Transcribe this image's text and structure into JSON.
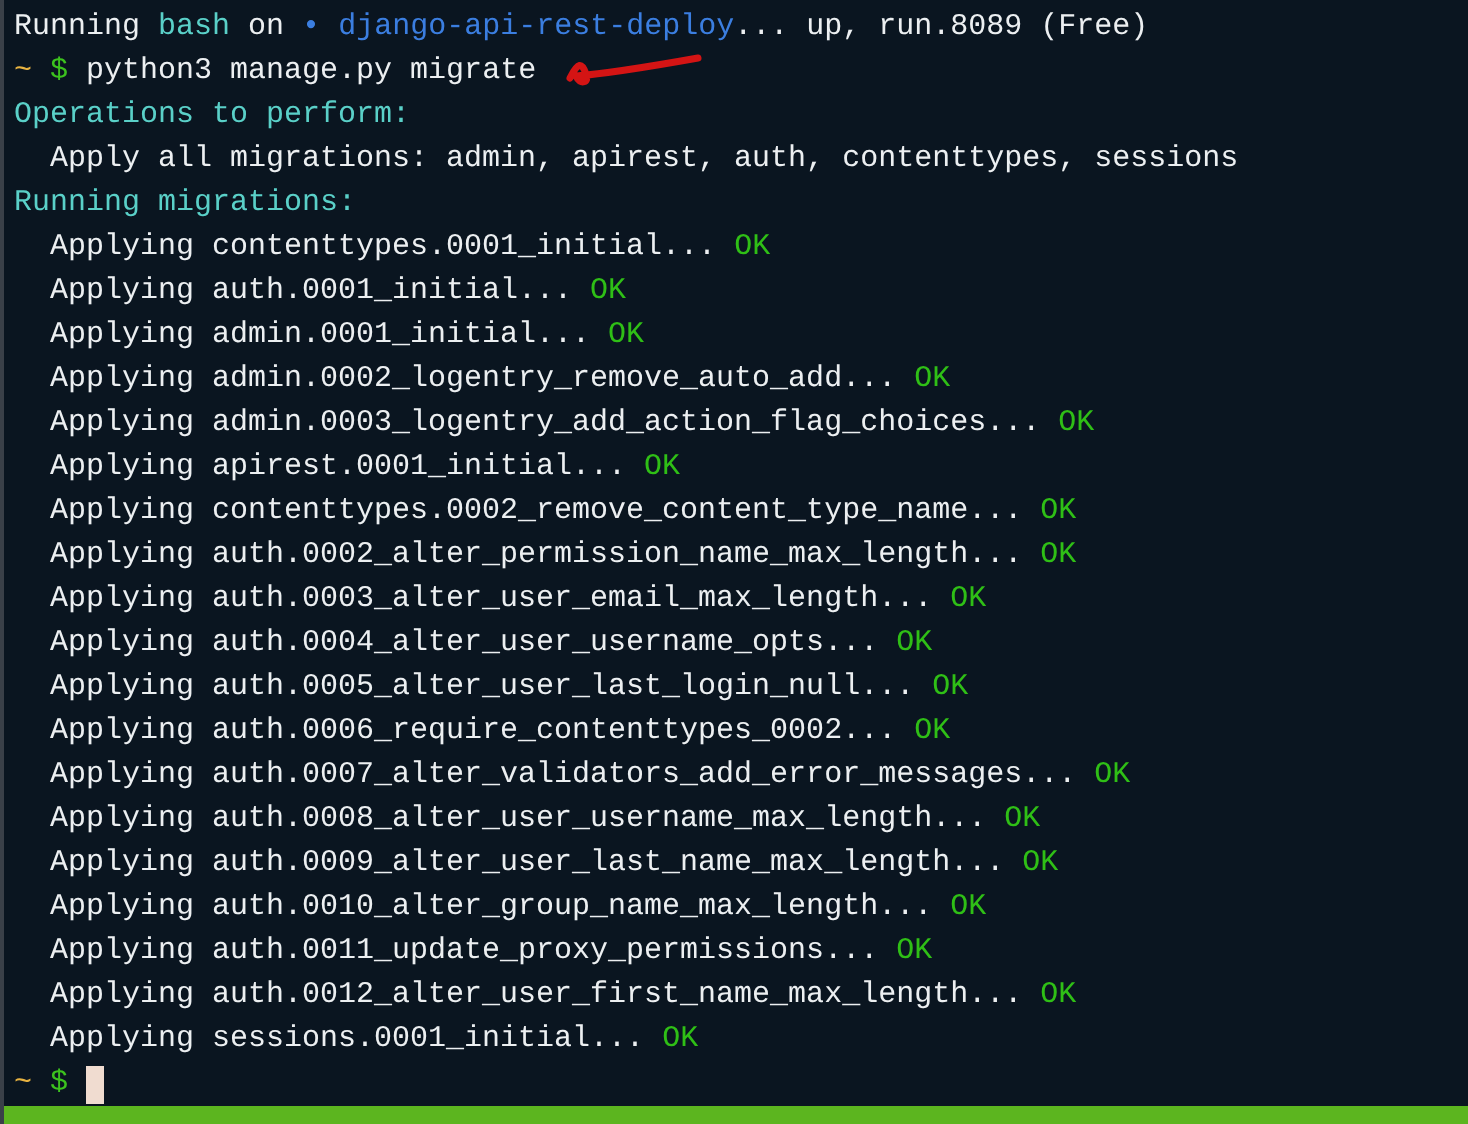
{
  "header": {
    "prefix": "Running",
    "shell": "bash",
    "on": "on",
    "bullet": "•",
    "project": "django-api-rest-deploy",
    "rest": "... up, run.8089 (Free)"
  },
  "prompt": {
    "dir": "~",
    "symbol": "$",
    "command": "python3 manage.py migrate"
  },
  "lines": [
    {
      "kind": "heading",
      "text": "Operations to perform:"
    },
    {
      "kind": "text",
      "text": "Apply all migrations: admin, apirest, auth, contenttypes, sessions"
    },
    {
      "kind": "heading",
      "text": "Running migrations:"
    },
    {
      "kind": "migration",
      "text": "Applying contenttypes.0001_initial...",
      "status": "OK"
    },
    {
      "kind": "migration",
      "text": "Applying auth.0001_initial...",
      "status": "OK"
    },
    {
      "kind": "migration",
      "text": "Applying admin.0001_initial...",
      "status": "OK"
    },
    {
      "kind": "migration",
      "text": "Applying admin.0002_logentry_remove_auto_add...",
      "status": "OK"
    },
    {
      "kind": "migration",
      "text": "Applying admin.0003_logentry_add_action_flag_choices...",
      "status": "OK"
    },
    {
      "kind": "migration",
      "text": "Applying apirest.0001_initial...",
      "status": "OK"
    },
    {
      "kind": "migration",
      "text": "Applying contenttypes.0002_remove_content_type_name...",
      "status": "OK"
    },
    {
      "kind": "migration",
      "text": "Applying auth.0002_alter_permission_name_max_length...",
      "status": "OK"
    },
    {
      "kind": "migration",
      "text": "Applying auth.0003_alter_user_email_max_length...",
      "status": "OK"
    },
    {
      "kind": "migration",
      "text": "Applying auth.0004_alter_user_username_opts...",
      "status": "OK"
    },
    {
      "kind": "migration",
      "text": "Applying auth.0005_alter_user_last_login_null...",
      "status": "OK"
    },
    {
      "kind": "migration",
      "text": "Applying auth.0006_require_contenttypes_0002...",
      "status": "OK"
    },
    {
      "kind": "migration",
      "text": "Applying auth.0007_alter_validators_add_error_messages...",
      "status": "OK"
    },
    {
      "kind": "migration",
      "text": "Applying auth.0008_alter_user_username_max_length...",
      "status": "OK"
    },
    {
      "kind": "migration",
      "text": "Applying auth.0009_alter_user_last_name_max_length...",
      "status": "OK"
    },
    {
      "kind": "migration",
      "text": "Applying auth.0010_alter_group_name_max_length...",
      "status": "OK"
    },
    {
      "kind": "migration",
      "text": "Applying auth.0011_update_proxy_permissions...",
      "status": "OK"
    },
    {
      "kind": "migration",
      "text": "Applying auth.0012_alter_user_first_name_max_length...",
      "status": "OK"
    },
    {
      "kind": "migration",
      "text": "Applying sessions.0001_initial...",
      "status": "OK"
    }
  ],
  "final_prompt": {
    "dir": "~",
    "symbol": "$"
  }
}
